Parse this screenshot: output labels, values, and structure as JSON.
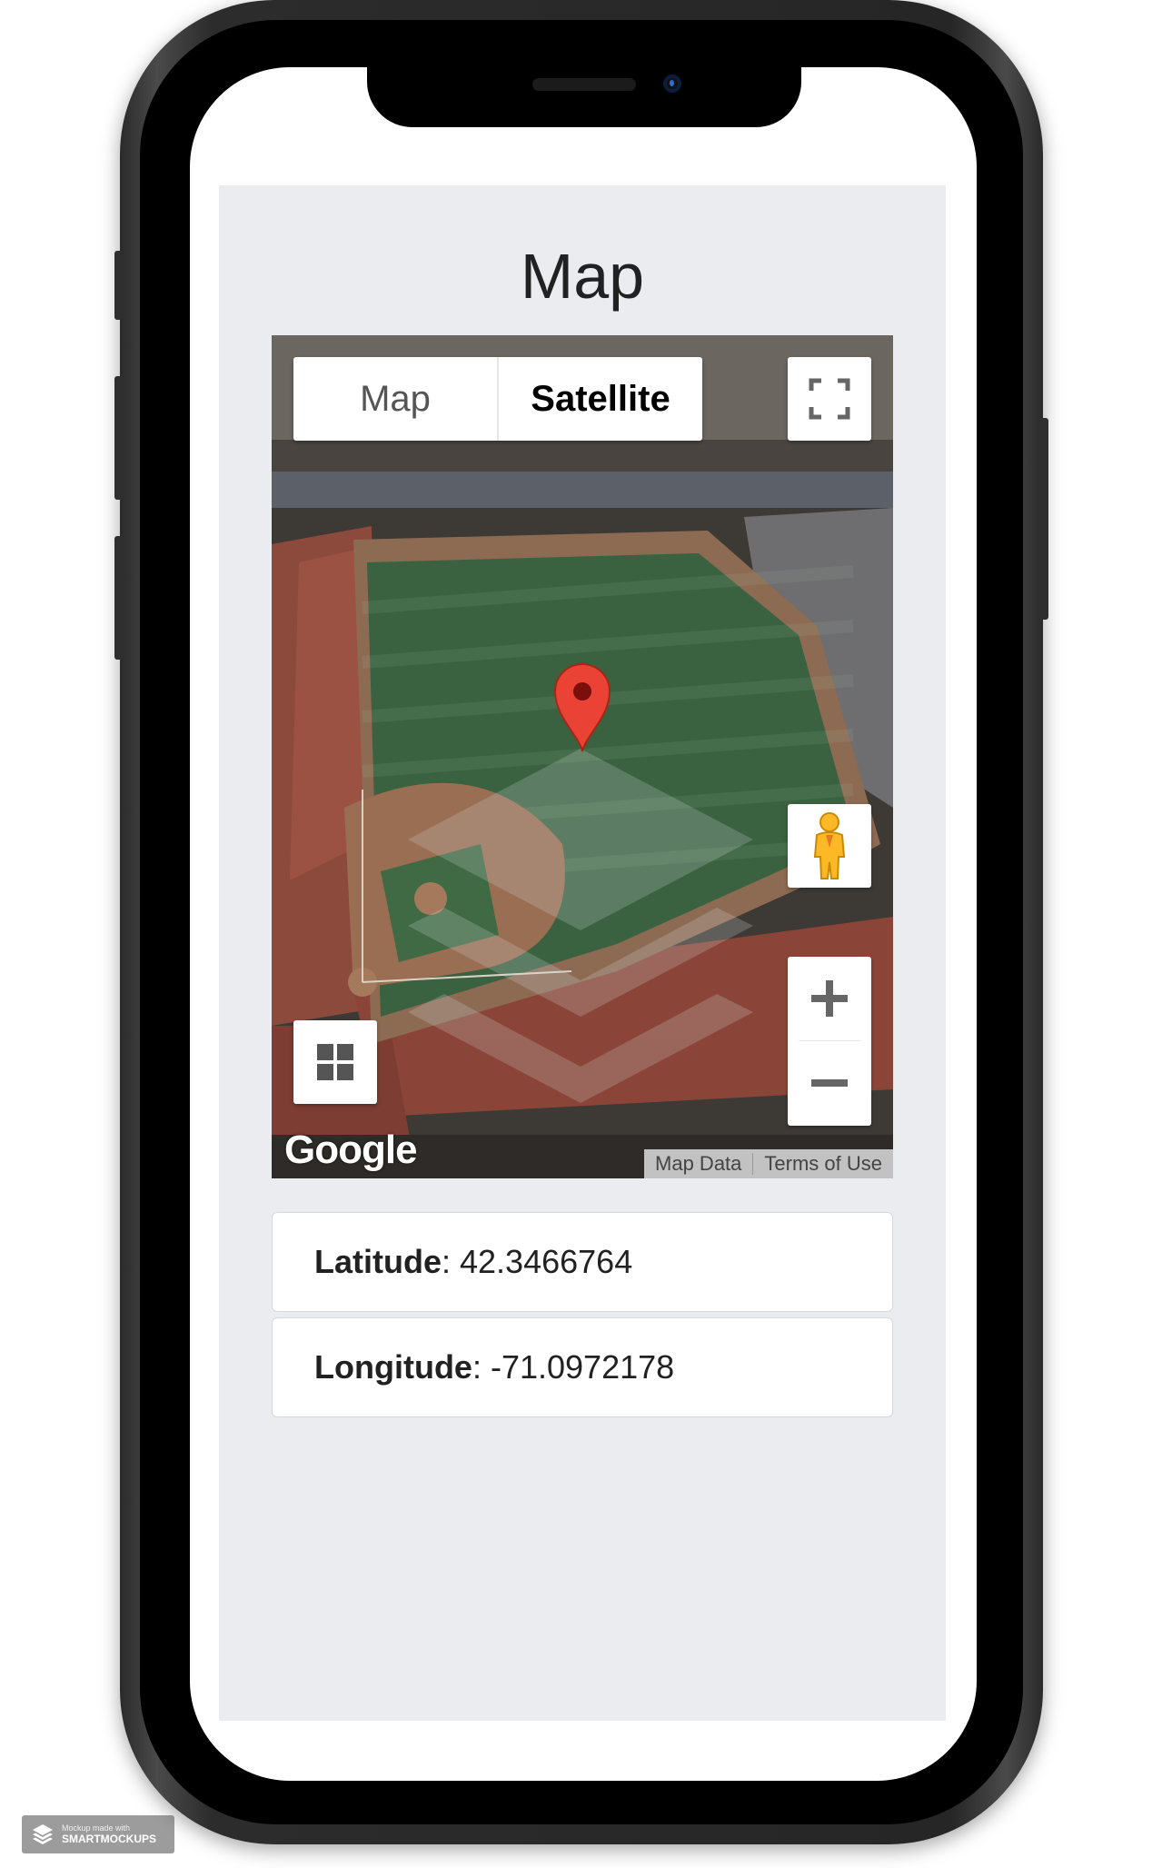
{
  "page": {
    "title": "Map"
  },
  "map": {
    "type_options": [
      {
        "label": "Map",
        "selected": false
      },
      {
        "label": "Satellite",
        "selected": true
      }
    ],
    "logo": "Google",
    "attribution": {
      "map_data": "Map Data",
      "terms": "Terms of Use"
    },
    "icons": {
      "fullscreen": "fullscreen-icon",
      "pegman": "pegman-icon",
      "zoom_in": "plus-icon",
      "zoom_out": "minus-icon",
      "layers": "grid-icon",
      "marker": "map-pin-icon"
    },
    "marker_color": "#ea4335"
  },
  "location": {
    "latitude_label": "Latitude",
    "latitude_value": "42.3466764",
    "longitude_label": "Longitude",
    "longitude_value": "-71.0972178"
  },
  "watermark": {
    "line1": "Mockup made with",
    "line2": "SMARTMOCKUPS"
  }
}
